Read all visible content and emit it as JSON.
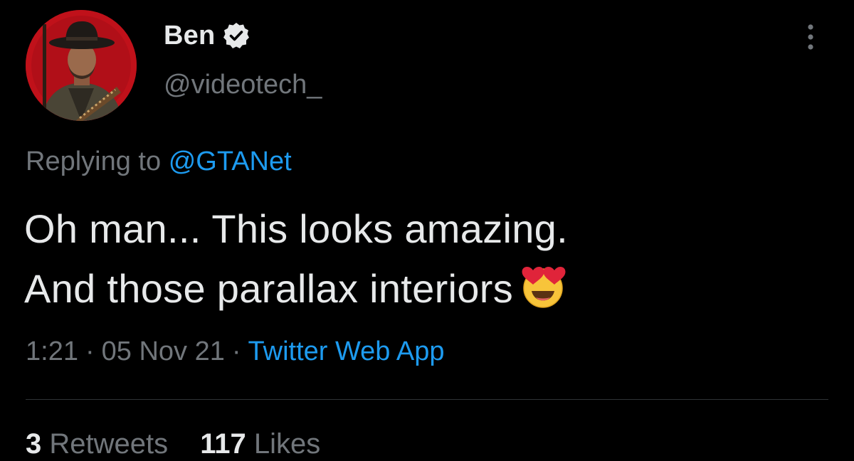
{
  "author": {
    "display_name": "Ben",
    "handle": "@videotech_",
    "avatar_icon": "avatar-cowboy",
    "verified": true
  },
  "reply": {
    "prefix": "Replying to",
    "mention": "@GTANet"
  },
  "tweet": {
    "line1": "Oh man... This looks amazing.",
    "line2": "And those parallax interiors",
    "emoji": "heart-eyes-emoji-icon"
  },
  "meta": {
    "time": "1:21",
    "separator": "·",
    "date": "05 Nov 21",
    "source": "Twitter Web App"
  },
  "stats": {
    "retweets_count": "3",
    "retweets_label": "Retweets",
    "likes_count": "117",
    "likes_label": "Likes"
  },
  "colors": {
    "background": "#000000",
    "text_primary": "#e7e9ea",
    "text_secondary": "#71767b",
    "link": "#1d9bf0",
    "divider": "#2f3336"
  }
}
